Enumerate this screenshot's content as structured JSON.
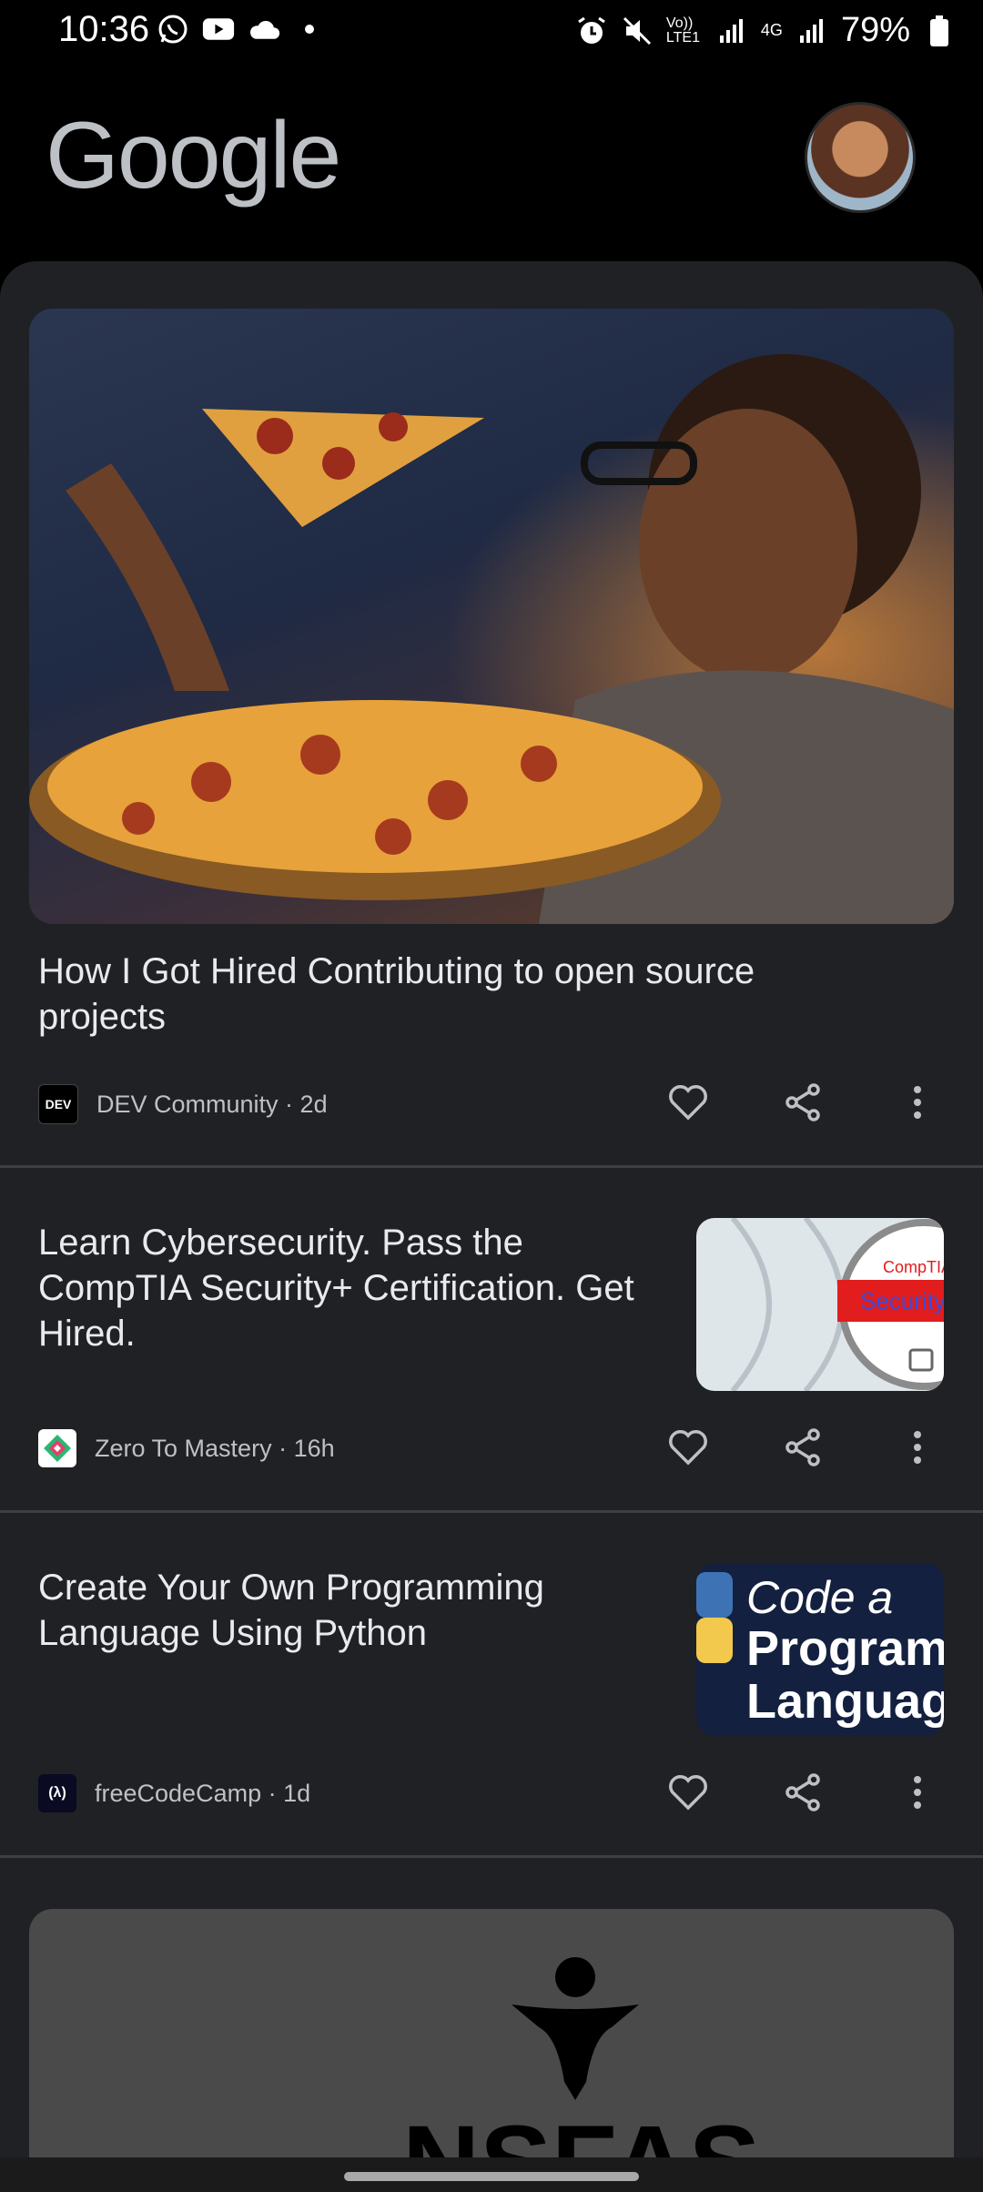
{
  "status_bar": {
    "time": "10:36",
    "battery": "79%",
    "network_label": "Vo)) LTE1",
    "net_4g": "4G"
  },
  "header": {
    "logo_text": "Google"
  },
  "cards": [
    {
      "title": "How I Got Hired Contributing to open source projects",
      "source": "DEV Community",
      "age": "2d",
      "logo_text": "DEV"
    },
    {
      "title": "Learn Cybersecurity. Pass the CompTIA Security+ Certification. Get Hired.",
      "source": "Zero To Mastery",
      "age": "16h",
      "thumb_text_1": "CompTIA",
      "thumb_text_2": "Security"
    },
    {
      "title": "Create Your Own Programming Language Using Python",
      "source": "freeCodeCamp",
      "age": "1d",
      "logo_text": "(λ)",
      "thumb_lines": [
        "Code a",
        "Program",
        "Languag"
      ]
    }
  ],
  "bottom_card": {
    "logo_text": "NSFAS"
  },
  "colors": {
    "background": "#000000",
    "feed_bg": "#202124",
    "text_primary": "#e8eaed",
    "text_secondary": "#bdc1c6"
  }
}
